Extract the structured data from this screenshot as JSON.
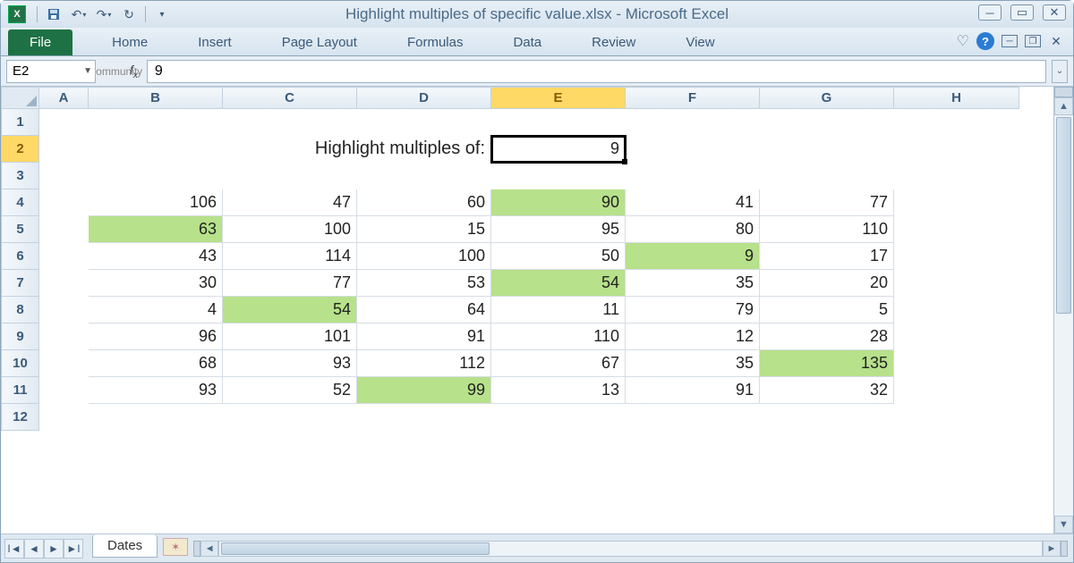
{
  "title": "Highlight multiples of specific value.xlsx  -  Microsoft Excel",
  "qat": {
    "save": "save-icon",
    "undo": "undo-icon",
    "redo": "redo-icon",
    "touch": "touch-icon"
  },
  "ribbon": {
    "file": "File",
    "tabs": [
      "Home",
      "Insert",
      "Page Layout",
      "Formulas",
      "Data",
      "Review",
      "View"
    ]
  },
  "namebox": "E2",
  "formula": "9",
  "sheet": {
    "columns": [
      "A",
      "B",
      "C",
      "D",
      "E",
      "F",
      "G",
      "H"
    ],
    "active_col": "E",
    "active_row": 2,
    "label_text": "Highlight multiples of:",
    "active_value": "9",
    "highlight_divisor": 9,
    "data_start_row": 4,
    "data_cols": [
      "B",
      "C",
      "D",
      "E",
      "F",
      "G"
    ],
    "data": [
      [
        106,
        47,
        60,
        90,
        41,
        77
      ],
      [
        63,
        100,
        15,
        95,
        80,
        110
      ],
      [
        43,
        114,
        100,
        50,
        9,
        17
      ],
      [
        30,
        77,
        53,
        54,
        35,
        20
      ],
      [
        4,
        54,
        64,
        11,
        79,
        5
      ],
      [
        96,
        101,
        91,
        110,
        12,
        28
      ],
      [
        68,
        93,
        112,
        67,
        35,
        135
      ],
      [
        93,
        52,
        99,
        13,
        91,
        32
      ]
    ],
    "visible_rows": 12
  },
  "tabs": {
    "active_sheet": "Dates"
  }
}
